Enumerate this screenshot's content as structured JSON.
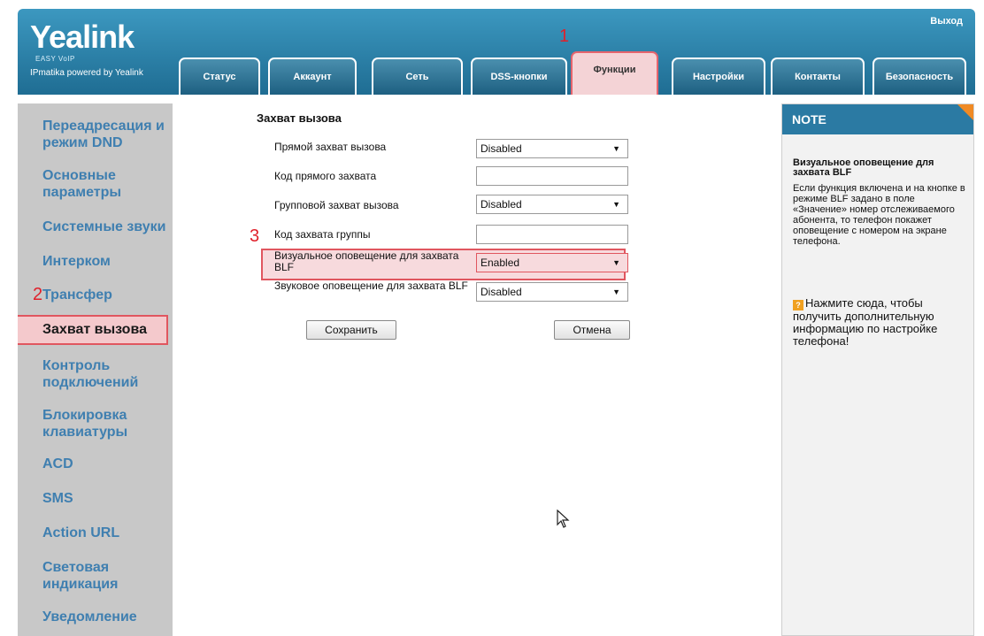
{
  "header": {
    "logo": "Yealink",
    "logo_sub": "EASY VoIP",
    "logo_powered": "IPmatika powered by Yealink",
    "logout": "Выход"
  },
  "tabs": [
    {
      "label": "Статус"
    },
    {
      "label": "Аккаунт"
    },
    {
      "label": "Сеть"
    },
    {
      "label": "DSS-кнопки"
    },
    {
      "label": "Функции",
      "active": true
    },
    {
      "label": "Настройки"
    },
    {
      "label": "Контакты"
    },
    {
      "label": "Безопасность"
    }
  ],
  "annotations": {
    "mark1": "1",
    "mark2": "2",
    "mark3": "3"
  },
  "sidebar": {
    "items": [
      {
        "label": "Переадресация и режим DND"
      },
      {
        "label": "Основные параметры"
      },
      {
        "label": "Системные звуки"
      },
      {
        "label": "Интерком"
      },
      {
        "label": "Трансфер"
      },
      {
        "label": "Захват вызова",
        "active": true
      },
      {
        "label": "Контроль подключений"
      },
      {
        "label": "Блокировка клавиатуры"
      },
      {
        "label": "ACD"
      },
      {
        "label": "SMS"
      },
      {
        "label": "Action URL"
      },
      {
        "label": "Световая индикация"
      },
      {
        "label": "Уведомление"
      }
    ]
  },
  "main": {
    "title": "Захват вызова",
    "rows": [
      {
        "label": "Прямой захват вызова",
        "type": "select",
        "value": "Disabled"
      },
      {
        "label": "Код прямого захвата",
        "type": "text",
        "value": ""
      },
      {
        "label": "Групповой захват вызова",
        "type": "select",
        "value": "Disabled"
      },
      {
        "label": "Код захвата группы",
        "type": "text",
        "value": ""
      },
      {
        "label": "Визуальное оповещение для захвата BLF",
        "type": "select",
        "value": "Enabled"
      },
      {
        "label": "Звуковое оповещение для захвата BLF",
        "type": "select",
        "value": "Disabled"
      }
    ],
    "save_label": "Сохранить",
    "cancel_label": "Отмена"
  },
  "note": {
    "header": "NOTE",
    "title": "Визуальное оповещение для захвата BLF",
    "text": "Если функция включена и на кнопке в режиме BLF задано в поле «Значение» номер отслеживаемого абонента, то телефон покажет оповещение с номером на экране телефона.",
    "help_icon": "?",
    "help": "Нажмите сюда, чтобы получить дополнительную информацию по настройке телефона!"
  },
  "colors": {
    "header_blue": "#2b7aa3",
    "accent_red": "#e0565f",
    "highlight_pink": "#f4c9cc",
    "sidebar_link": "#3f7fb0",
    "note_orange": "#f08a24"
  },
  "icons": [
    "dropdown-arrow-icon",
    "help-icon",
    "mouse-pointer-icon"
  ]
}
